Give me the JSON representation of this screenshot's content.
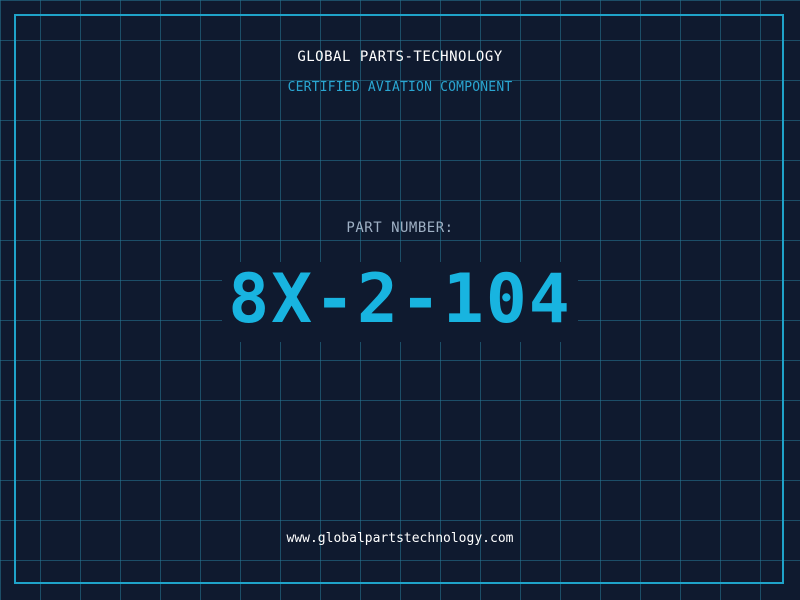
{
  "header": {
    "company_name": "GLOBAL PARTS-TECHNOLOGY",
    "subtitle": "CERTIFIED AVIATION COMPONENT"
  },
  "part": {
    "label": "PART NUMBER:",
    "number": "8X-2-104"
  },
  "footer": {
    "website": "www.globalpartstechnology.com"
  },
  "colors": {
    "background": "#0f1a2f",
    "grid": "#267896",
    "accent": "#18b4e0",
    "frame": "#1fa3c9"
  }
}
